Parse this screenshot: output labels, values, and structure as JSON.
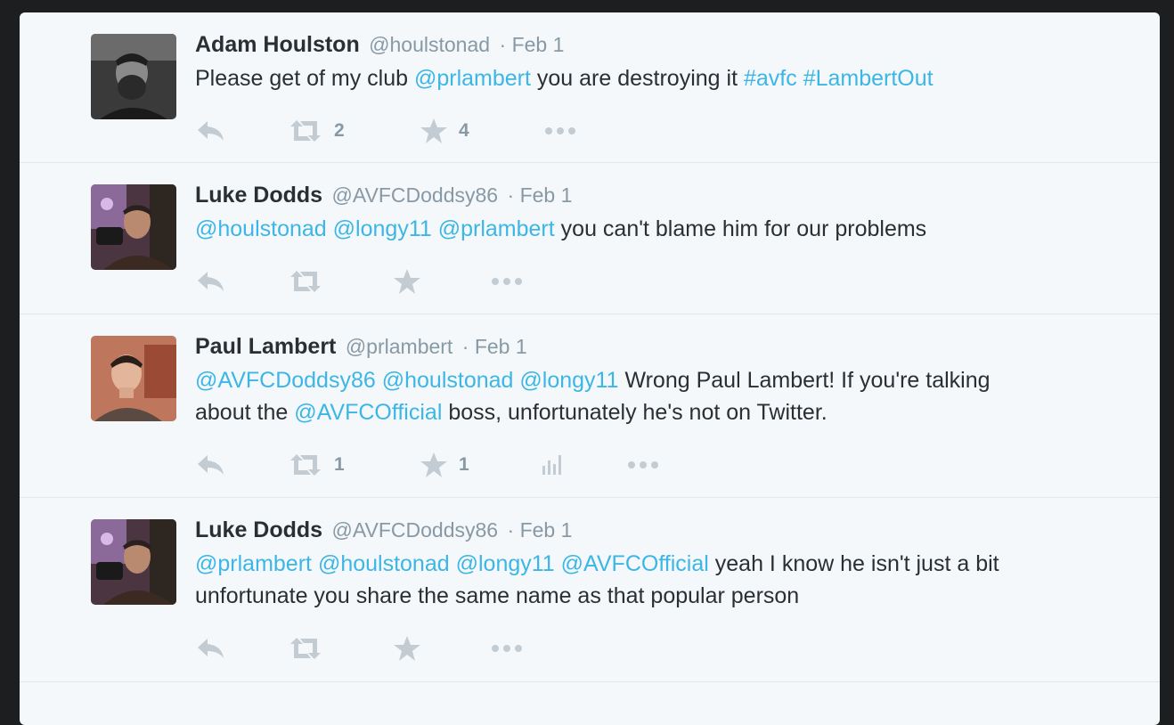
{
  "tweets": [
    {
      "name": "Adam Houlston",
      "handle": "@houlstonad",
      "date": "· Feb 1",
      "line1": [
        {
          "t": "Please get of my club ",
          "link": false
        },
        {
          "t": "@prlambert",
          "link": true
        },
        {
          "t": " you are destroying it ",
          "link": false
        },
        {
          "t": "#avfc",
          "link": true
        },
        {
          "t": " ",
          "link": false
        },
        {
          "t": "#LambertOut",
          "link": true
        }
      ],
      "retweets": "2",
      "favorites": "4"
    },
    {
      "name": "Luke Dodds",
      "handle": "@AVFCDoddsy86",
      "date": "· Feb 1",
      "line1": [
        {
          "t": "@houlstonad",
          "link": true
        },
        {
          "t": " ",
          "link": false
        },
        {
          "t": "@longy11",
          "link": true
        },
        {
          "t": " ",
          "link": false
        },
        {
          "t": "@prlambert",
          "link": true
        },
        {
          "t": " you can't blame him for our problems",
          "link": false
        }
      ]
    },
    {
      "name": "Paul Lambert",
      "handle": "@prlambert",
      "date": "· Feb 1",
      "line1": [
        {
          "t": "@AVFCDoddsy86",
          "link": true
        },
        {
          "t": " ",
          "link": false
        },
        {
          "t": "@houlstonad",
          "link": true
        },
        {
          "t": " ",
          "link": false
        },
        {
          "t": "@longy11",
          "link": true
        },
        {
          "t": " Wrong Paul Lambert! If you're talking",
          "link": false
        }
      ],
      "line2": [
        {
          "t": "about the ",
          "link": false
        },
        {
          "t": "@AVFCOfficial",
          "link": true
        },
        {
          "t": " boss, unfortunately he's not on Twitter.",
          "link": false
        }
      ],
      "retweets": "1",
      "favorites": "1"
    },
    {
      "name": "Luke Dodds",
      "handle": "@AVFCDoddsy86",
      "date": "· Feb 1",
      "line1": [
        {
          "t": "@prlambert",
          "link": true
        },
        {
          "t": " ",
          "link": false
        },
        {
          "t": "@houlstonad",
          "link": true
        },
        {
          "t": " ",
          "link": false
        },
        {
          "t": "@longy11",
          "link": true
        },
        {
          "t": " ",
          "link": false
        },
        {
          "t": "@AVFCOfficial",
          "link": true
        },
        {
          "t": " yeah I know he isn't just a bit",
          "link": false
        }
      ],
      "line2": [
        {
          "t": "unfortunate you share the same name as that popular person",
          "link": false
        }
      ]
    }
  ],
  "icons": [
    "reply-icon",
    "retweet-icon",
    "favorite-icon",
    "analytics-icon",
    "more-icon"
  ],
  "colors": {
    "link": "#3bb6e6",
    "icon": "#c3ccd3",
    "meta": "#8899a6",
    "text": "#292f33"
  }
}
